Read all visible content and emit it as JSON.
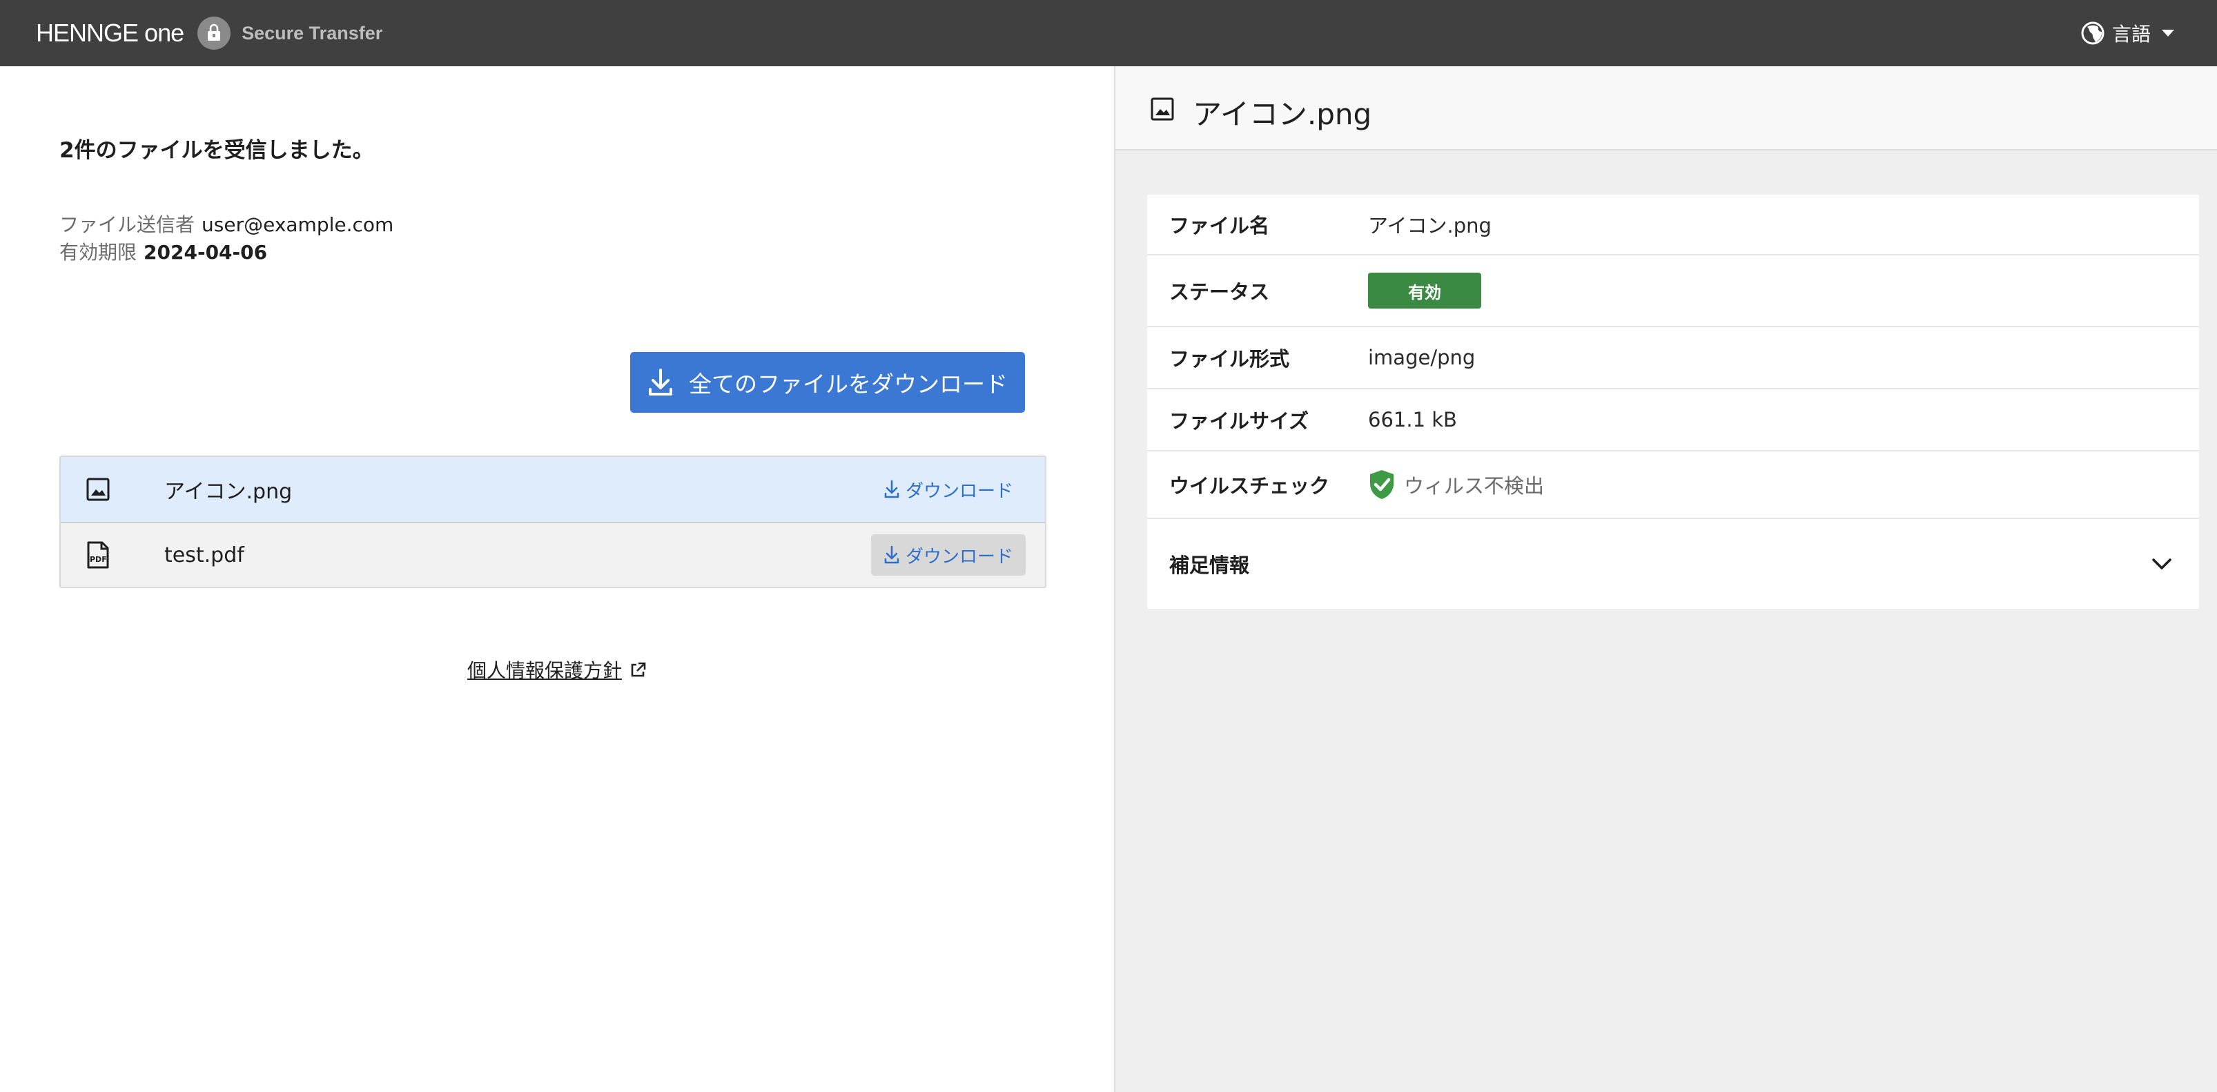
{
  "header": {
    "brand_prefix": "HENNGE",
    "brand_suffix": "one",
    "product_name": "Secure Transfer",
    "language_label": "言語"
  },
  "main": {
    "received_title": "2件のファイルを受信しました。",
    "sender_label": "ファイル送信者",
    "sender_value": "user@example.com",
    "expiry_label": "有効期限",
    "expiry_value": "2024-04-06",
    "download_all_label": "全てのファイルをダウンロード",
    "files": [
      {
        "name": "アイコン.png",
        "icon": "image-icon",
        "download_label": "ダウンロード"
      },
      {
        "name": "test.pdf",
        "icon": "pdf-icon",
        "download_label": "ダウンロード"
      }
    ],
    "privacy_link": "個人情報保護方針"
  },
  "detail": {
    "title": "アイコン.png",
    "rows": {
      "filename_label": "ファイル名",
      "filename_value": "アイコン.png",
      "status_label": "ステータス",
      "status_value": "有効",
      "filetype_label": "ファイル形式",
      "filetype_value": "image/png",
      "filesize_label": "ファイルサイズ",
      "filesize_value": "661.1 kB",
      "viruscheck_label": "ウイルスチェック",
      "viruscheck_value": "ウィルス不検出"
    },
    "supplement_label": "補足情報"
  },
  "colors": {
    "header_bg": "#404040",
    "primary": "#3b78d4",
    "status_ok": "#3b8a43",
    "selected_row": "#dfecfb"
  }
}
